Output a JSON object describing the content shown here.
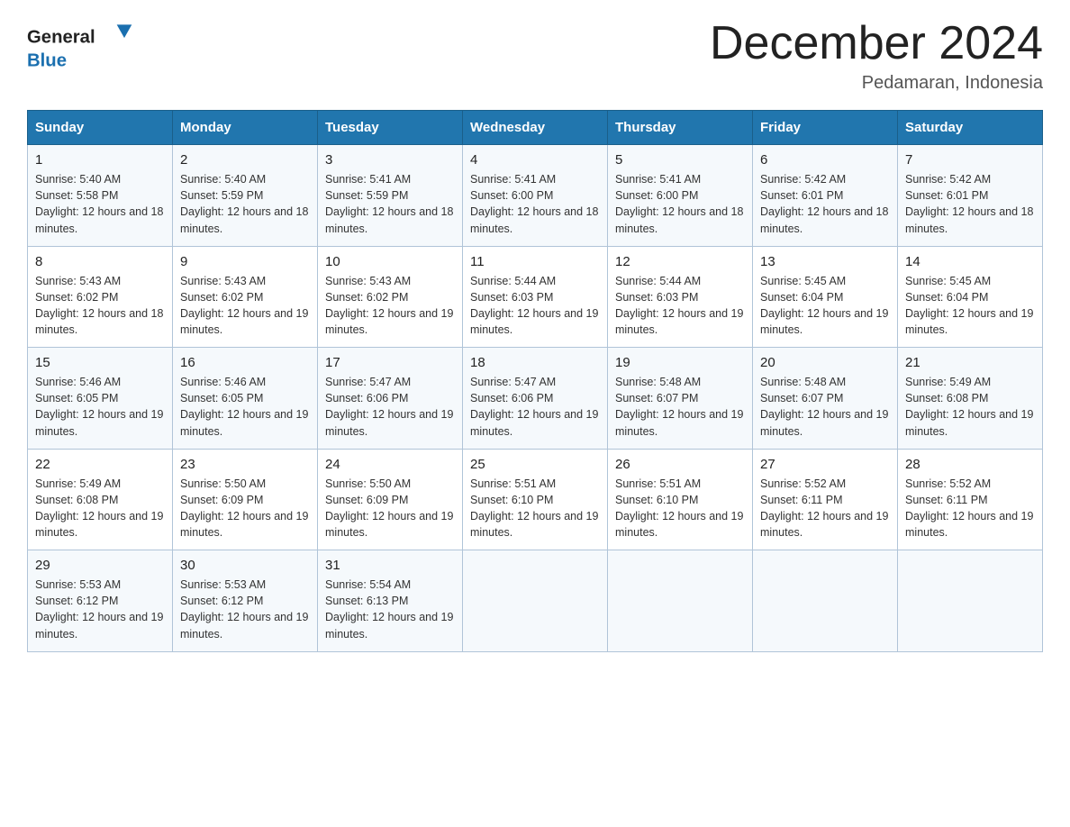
{
  "header": {
    "title": "December 2024",
    "subtitle": "Pedamaran, Indonesia",
    "logo_general": "General",
    "logo_blue": "Blue"
  },
  "weekdays": [
    "Sunday",
    "Monday",
    "Tuesday",
    "Wednesday",
    "Thursday",
    "Friday",
    "Saturday"
  ],
  "weeks": [
    [
      {
        "day": "1",
        "sunrise": "5:40 AM",
        "sunset": "5:58 PM",
        "daylight": "12 hours and 18 minutes."
      },
      {
        "day": "2",
        "sunrise": "5:40 AM",
        "sunset": "5:59 PM",
        "daylight": "12 hours and 18 minutes."
      },
      {
        "day": "3",
        "sunrise": "5:41 AM",
        "sunset": "5:59 PM",
        "daylight": "12 hours and 18 minutes."
      },
      {
        "day": "4",
        "sunrise": "5:41 AM",
        "sunset": "6:00 PM",
        "daylight": "12 hours and 18 minutes."
      },
      {
        "day": "5",
        "sunrise": "5:41 AM",
        "sunset": "6:00 PM",
        "daylight": "12 hours and 18 minutes."
      },
      {
        "day": "6",
        "sunrise": "5:42 AM",
        "sunset": "6:01 PM",
        "daylight": "12 hours and 18 minutes."
      },
      {
        "day": "7",
        "sunrise": "5:42 AM",
        "sunset": "6:01 PM",
        "daylight": "12 hours and 18 minutes."
      }
    ],
    [
      {
        "day": "8",
        "sunrise": "5:43 AM",
        "sunset": "6:02 PM",
        "daylight": "12 hours and 18 minutes."
      },
      {
        "day": "9",
        "sunrise": "5:43 AM",
        "sunset": "6:02 PM",
        "daylight": "12 hours and 19 minutes."
      },
      {
        "day": "10",
        "sunrise": "5:43 AM",
        "sunset": "6:02 PM",
        "daylight": "12 hours and 19 minutes."
      },
      {
        "day": "11",
        "sunrise": "5:44 AM",
        "sunset": "6:03 PM",
        "daylight": "12 hours and 19 minutes."
      },
      {
        "day": "12",
        "sunrise": "5:44 AM",
        "sunset": "6:03 PM",
        "daylight": "12 hours and 19 minutes."
      },
      {
        "day": "13",
        "sunrise": "5:45 AM",
        "sunset": "6:04 PM",
        "daylight": "12 hours and 19 minutes."
      },
      {
        "day": "14",
        "sunrise": "5:45 AM",
        "sunset": "6:04 PM",
        "daylight": "12 hours and 19 minutes."
      }
    ],
    [
      {
        "day": "15",
        "sunrise": "5:46 AM",
        "sunset": "6:05 PM",
        "daylight": "12 hours and 19 minutes."
      },
      {
        "day": "16",
        "sunrise": "5:46 AM",
        "sunset": "6:05 PM",
        "daylight": "12 hours and 19 minutes."
      },
      {
        "day": "17",
        "sunrise": "5:47 AM",
        "sunset": "6:06 PM",
        "daylight": "12 hours and 19 minutes."
      },
      {
        "day": "18",
        "sunrise": "5:47 AM",
        "sunset": "6:06 PM",
        "daylight": "12 hours and 19 minutes."
      },
      {
        "day": "19",
        "sunrise": "5:48 AM",
        "sunset": "6:07 PM",
        "daylight": "12 hours and 19 minutes."
      },
      {
        "day": "20",
        "sunrise": "5:48 AM",
        "sunset": "6:07 PM",
        "daylight": "12 hours and 19 minutes."
      },
      {
        "day": "21",
        "sunrise": "5:49 AM",
        "sunset": "6:08 PM",
        "daylight": "12 hours and 19 minutes."
      }
    ],
    [
      {
        "day": "22",
        "sunrise": "5:49 AM",
        "sunset": "6:08 PM",
        "daylight": "12 hours and 19 minutes."
      },
      {
        "day": "23",
        "sunrise": "5:50 AM",
        "sunset": "6:09 PM",
        "daylight": "12 hours and 19 minutes."
      },
      {
        "day": "24",
        "sunrise": "5:50 AM",
        "sunset": "6:09 PM",
        "daylight": "12 hours and 19 minutes."
      },
      {
        "day": "25",
        "sunrise": "5:51 AM",
        "sunset": "6:10 PM",
        "daylight": "12 hours and 19 minutes."
      },
      {
        "day": "26",
        "sunrise": "5:51 AM",
        "sunset": "6:10 PM",
        "daylight": "12 hours and 19 minutes."
      },
      {
        "day": "27",
        "sunrise": "5:52 AM",
        "sunset": "6:11 PM",
        "daylight": "12 hours and 19 minutes."
      },
      {
        "day": "28",
        "sunrise": "5:52 AM",
        "sunset": "6:11 PM",
        "daylight": "12 hours and 19 minutes."
      }
    ],
    [
      {
        "day": "29",
        "sunrise": "5:53 AM",
        "sunset": "6:12 PM",
        "daylight": "12 hours and 19 minutes."
      },
      {
        "day": "30",
        "sunrise": "5:53 AM",
        "sunset": "6:12 PM",
        "daylight": "12 hours and 19 minutes."
      },
      {
        "day": "31",
        "sunrise": "5:54 AM",
        "sunset": "6:13 PM",
        "daylight": "12 hours and 19 minutes."
      },
      null,
      null,
      null,
      null
    ]
  ]
}
